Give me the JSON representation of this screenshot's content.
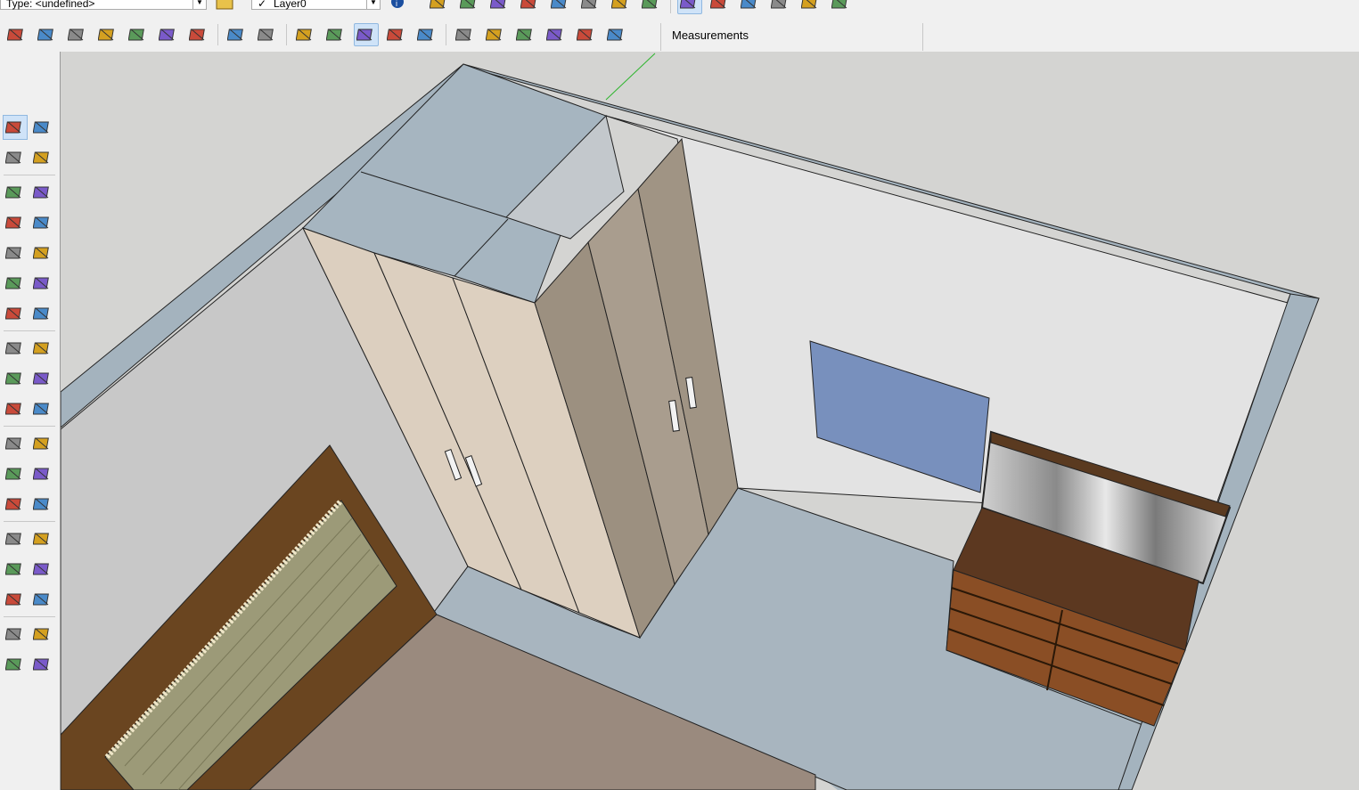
{
  "toolbar": {
    "entity_type_field": "Type: <undefined>",
    "layer_field": "Layer0",
    "layer_check": "✓",
    "measurements_label": "Measurements",
    "top_row_icons": [
      "layer-manager-icon",
      "entity-info-icon",
      "components-icon",
      "sandbox-icon",
      "shadow-icon",
      "section-icon",
      "ruby-icon",
      "view-iso-icon",
      "view-top-icon",
      "view-front-icon",
      "view-right-icon",
      "view-back-icon",
      "view-left-icon",
      "solid-union-icon",
      "solid-subtract-icon",
      "solid-trim-icon",
      "solid-intersect-icon",
      "solid-split-icon"
    ],
    "second_row_icons": [
      "sandbox-from-contours-icon",
      "sandbox-from-scratch-icon",
      "smoove-icon",
      "stamp-icon",
      "drape-icon",
      "add-detail-icon",
      "flip-edge-icon",
      "xray-icon",
      "back-edges-icon",
      "wireframe-icon",
      "hidden-line-icon",
      "shaded-icon",
      "shaded-with-textures-icon",
      "monochrome-icon",
      "iso-view-icon",
      "top-view-icon",
      "front-view-icon",
      "right-view-icon",
      "back-view-icon",
      "left-view-icon"
    ]
  },
  "tools": [
    [
      "select-tool-icon",
      "make-component-icon"
    ],
    [
      "paint-bucket-icon",
      "eraser-icon"
    ],
    [
      "line-tool-icon",
      "freehand-tool-icon"
    ],
    [
      "rectangle-tool-icon",
      "rotated-rectangle-icon"
    ],
    [
      "circle-tool-icon",
      "polygon-tool-icon"
    ],
    [
      "arc-tool-icon",
      "two-point-arc-icon"
    ],
    [
      "three-point-arc-icon",
      "pie-tool-icon"
    ],
    [
      "move-tool-icon",
      "push-pull-icon"
    ],
    [
      "rotate-tool-icon",
      "follow-me-icon"
    ],
    [
      "scale-tool-icon",
      "offset-tool-icon"
    ],
    [
      "tape-measure-icon",
      "dimension-tool-icon"
    ],
    [
      "protractor-icon",
      "text-tool-icon"
    ],
    [
      "axes-tool-icon",
      "3d-text-icon"
    ],
    [
      "orbit-tool-icon",
      "pan-tool-icon"
    ],
    [
      "zoom-tool-icon",
      "zoom-window-icon"
    ],
    [
      "zoom-extents-icon",
      "previous-view-icon"
    ],
    [
      "position-camera-icon",
      "look-around-icon"
    ],
    [
      "walk-tool-icon",
      "section-plane-icon"
    ]
  ],
  "colors": {
    "wall_top": "#a5b4bf",
    "wardrobe_light": "#dccfbf",
    "wardrobe_dark": "#9c9080",
    "floor": "#a9b6bf",
    "window": "#7890bd",
    "dresser_wood": "#6b3a1c",
    "bed_frame": "#6a4520",
    "rug": "#9a8a7e"
  }
}
